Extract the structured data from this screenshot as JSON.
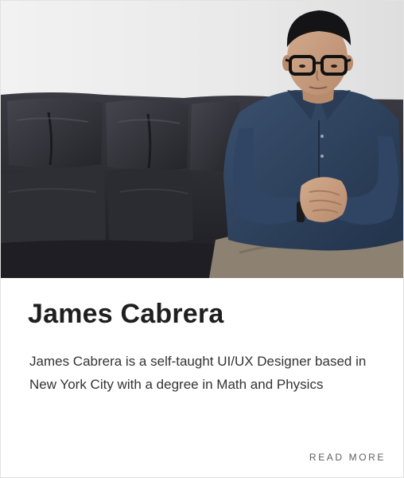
{
  "profile": {
    "name": "James Cabrera",
    "description": "James Cabrera is a self-taught UI/UX Designer based in New York City with a degree in Math and Physics",
    "read_more_label": "READ MORE"
  },
  "photo": {
    "alt": "Portrait of James Cabrera sitting on a black leather couch"
  },
  "colors": {
    "wall": "#e8e8e8",
    "couch": "#2a2a30",
    "shirt": "#2c3f5a",
    "skin": "#c49a7e",
    "pants": "#8d8171",
    "title_text": "#1f1f1f",
    "body_text": "#333333",
    "link_text": "#5e5e5e"
  }
}
